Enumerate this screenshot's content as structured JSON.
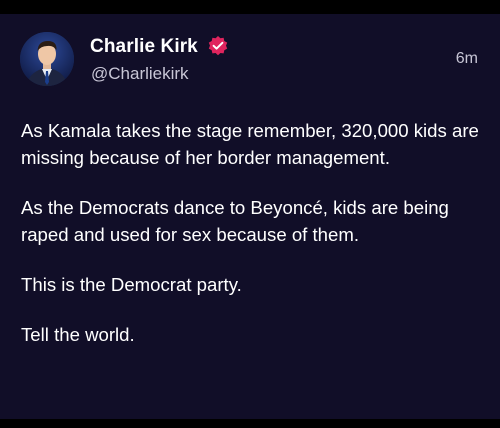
{
  "post": {
    "author": {
      "name": "Charlie Kirk",
      "handle": "@Charliekirk",
      "verified": true,
      "avatar_icon": "profile-photo"
    },
    "timestamp": "6m",
    "paragraphs": [
      "As Kamala takes the stage remember, 320,000 kids are missing because of her border management.",
      "As the Democrats dance to Beyoncé, kids are being raped and used for sex because of them.",
      "This is the Democrat party.",
      "Tell the world."
    ]
  },
  "colors": {
    "background": "#110e28",
    "outer": "#000000",
    "text": "#ffffff",
    "secondary_text": "#c8c6d6",
    "verified_badge": "#e0245e"
  }
}
